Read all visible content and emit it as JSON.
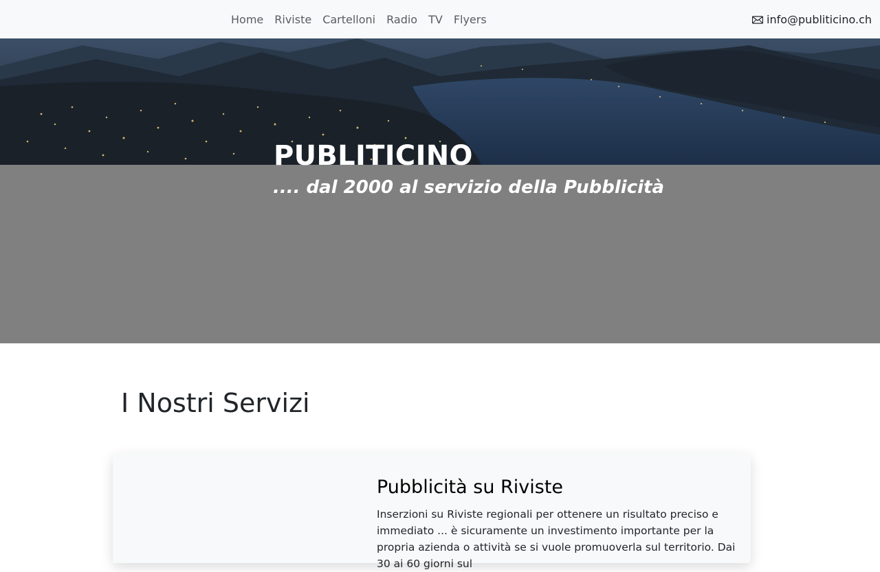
{
  "nav": {
    "links": [
      "Home",
      "Riviste",
      "Cartelloni",
      "Radio",
      "TV",
      "Flyers"
    ],
    "email": "info@publiticino.ch",
    "email_icon": "mail-icon"
  },
  "hero": {
    "title": "PUBLITICINO",
    "subtitle": ".... dal 2000 al servizio della Pubblicità",
    "overlay_color": "#808080"
  },
  "services": {
    "heading": "I Nostri Servizi",
    "cards": [
      {
        "title": "Pubblicità su Riviste",
        "text": "Inserzioni su Riviste regionali per ottenere un risultato preciso e immediato ... è sicuramente un investimento importante per la propria azienda o attività se si vuole promuoverla sul territorio. Dai 30 ai 60 giorni sul"
      }
    ]
  }
}
